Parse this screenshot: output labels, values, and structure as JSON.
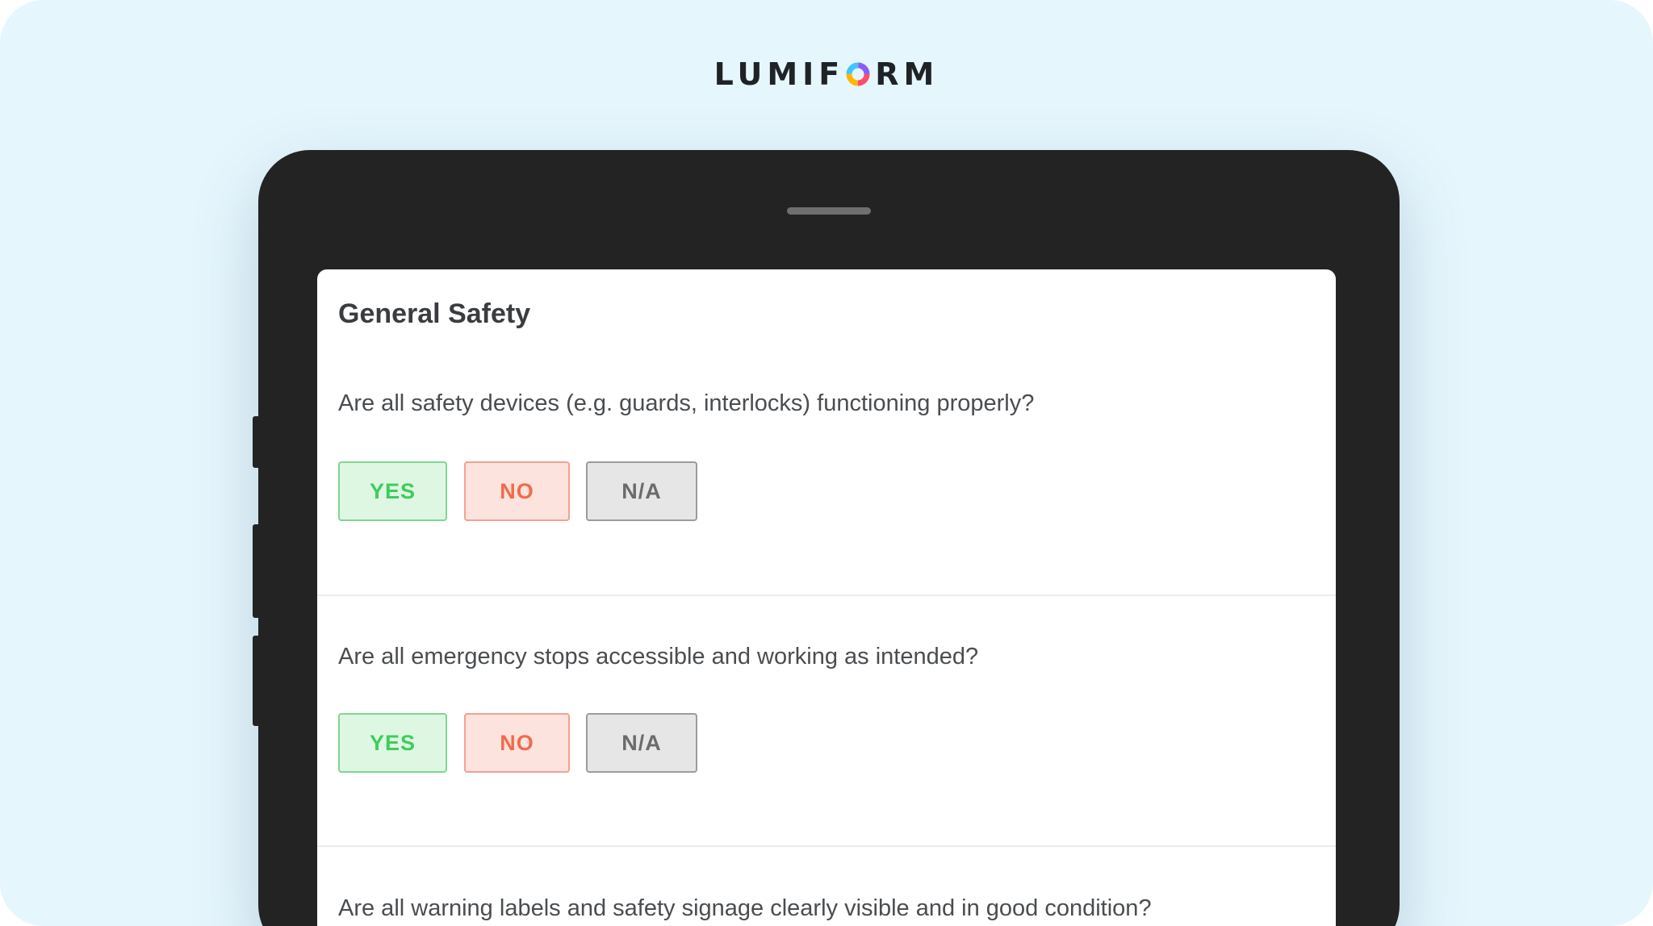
{
  "logo": {
    "text_before": "LUMIF",
    "text_after": "RM"
  },
  "form": {
    "section_title": "General Safety",
    "questions": [
      {
        "text": "Are all safety devices (e.g. guards, interlocks) functioning properly?",
        "yes": "YES",
        "no": "NO",
        "na": "N/A"
      },
      {
        "text": "Are all emergency stops accessible and working as intended?",
        "yes": "YES",
        "no": "NO",
        "na": "N/A"
      },
      {
        "text": "Are all warning labels and safety signage clearly visible and in good condition?"
      }
    ]
  },
  "colors": {
    "background": "#e6f6fd",
    "device": "#232324",
    "yes": "#3fcc5c",
    "no": "#f26a4b",
    "na": "#6b6b6b"
  }
}
